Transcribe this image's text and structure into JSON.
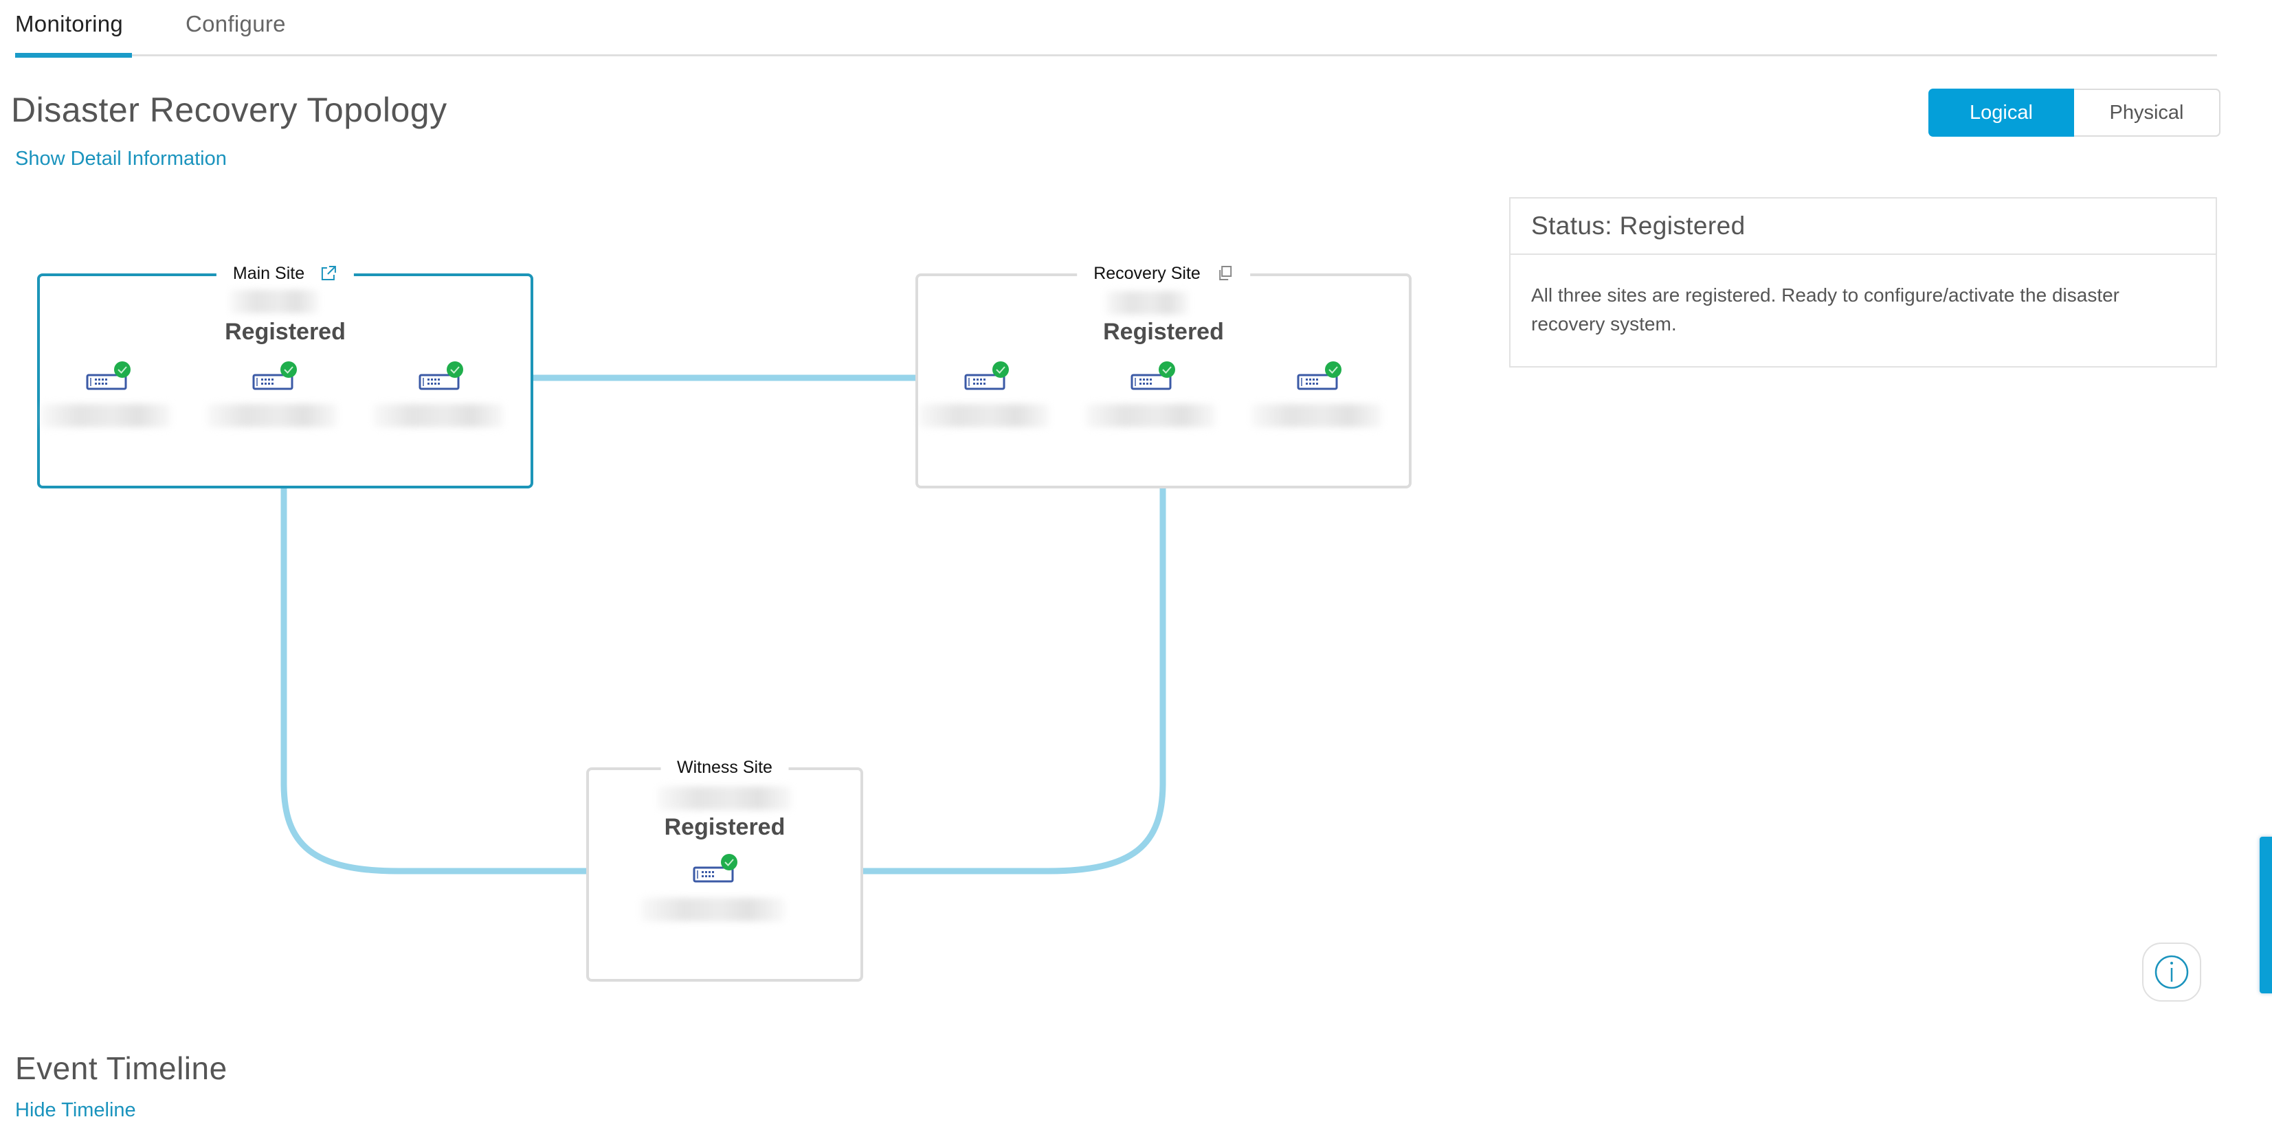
{
  "tabs": [
    {
      "label": "Monitoring",
      "active": true
    },
    {
      "label": "Configure",
      "active": false
    }
  ],
  "page_title": "Disaster Recovery Topology",
  "show_detail_link": "Show Detail Information",
  "view_toggle": {
    "options": [
      "Logical",
      "Physical"
    ],
    "selected": "Logical"
  },
  "status_panel": {
    "title": "Status: Registered",
    "message": "All three sites are registered. Ready to configure/activate the disaster recovery system."
  },
  "colors": {
    "accent": "#049fd9",
    "link": "#1a93bd",
    "main_site_border": "#1c95b8",
    "connector": "#97d4ea",
    "status_ok": "#1fae4c",
    "node_icon": "#3b5aa6"
  },
  "topology": {
    "sites": [
      {
        "name": "Main Site",
        "icon": "external-link-icon",
        "status": "Registered",
        "node_count": 3,
        "node_status": "ok",
        "selected": true
      },
      {
        "name": "Recovery Site",
        "icon": "copy-icon",
        "status": "Registered",
        "node_count": 3,
        "node_status": "ok",
        "selected": false
      },
      {
        "name": "Witness Site",
        "icon": null,
        "status": "Registered",
        "node_count": 1,
        "node_status": "ok",
        "selected": false
      }
    ],
    "links": [
      {
        "from": "Main Site",
        "to": "Recovery Site"
      },
      {
        "from": "Main Site",
        "to": "Witness Site"
      },
      {
        "from": "Recovery Site",
        "to": "Witness Site"
      }
    ]
  },
  "event_timeline": {
    "title": "Event Timeline",
    "toggle_link": "Hide Timeline"
  }
}
